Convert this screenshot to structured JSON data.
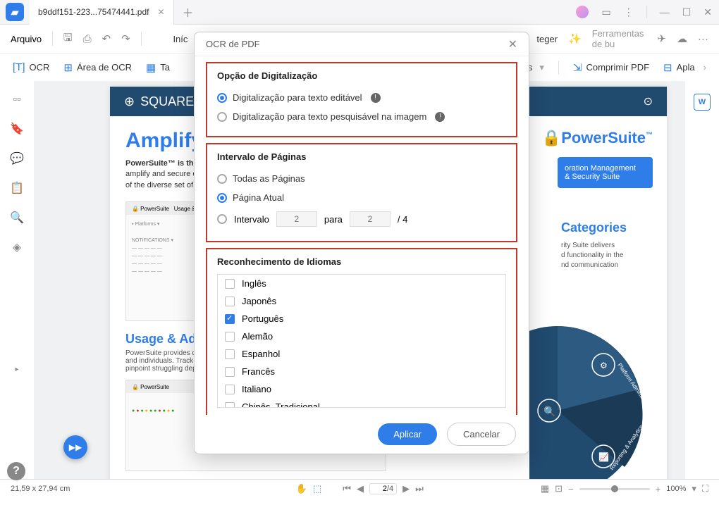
{
  "titlebar": {
    "tab_name": "b9ddf151-223...75474441.pdf"
  },
  "menubar": {
    "file": "Arquivo",
    "home": "Iníc",
    "protect": "teger",
    "ai_tools": "Ferramentas de bu"
  },
  "toolbar": {
    "ocr": "OCR",
    "ocr_area": "Área de OCR",
    "ta": "Ta",
    "vos": "vos",
    "compress": "Comprimir PDF",
    "apla": "Apla"
  },
  "dialog": {
    "title": "OCR de PDF",
    "scan": {
      "title": "Opção de Digitalização",
      "opt1": "Digitalização para texto editável",
      "opt2": "Digitalização para texto pesquisável na imagem"
    },
    "pagerange": {
      "title": "Intervalo de Páginas",
      "all": "Todas as Páginas",
      "current": "Página Atual",
      "range": "Intervalo",
      "from": "2",
      "to_label": "para",
      "to": "2",
      "total": "/ 4"
    },
    "lang": {
      "title": "Reconhecimento de Idiomas",
      "items": [
        {
          "label": "Inglês",
          "checked": false
        },
        {
          "label": "Japonês",
          "checked": false
        },
        {
          "label": "Português",
          "checked": true
        },
        {
          "label": "Alemão",
          "checked": false
        },
        {
          "label": "Espanhol",
          "checked": false
        },
        {
          "label": "Francês",
          "checked": false
        },
        {
          "label": "Italiano",
          "checked": false
        },
        {
          "label": "Chinês_Tradicional",
          "checked": false
        }
      ],
      "selected": "Português"
    },
    "apply": "Aplicar",
    "cancel": "Cancelar"
  },
  "document": {
    "square": "SQUARE",
    "heading": "Amplify C",
    "desc1": "PowerSuite™ is the",
    "desc2": "amplify and secure c",
    "desc3": "of the diverse set of",
    "ps": "PowerSuite",
    "badge1": "oration Management",
    "badge2": "& Security Suite",
    "categories": "Categories",
    "cat1": "rity Suite delivers",
    "cat2": "d functionality in the",
    "cat3": "nd communication",
    "usage": "Usage & Adoption",
    "usage1": "PowerSuite provides det",
    "usage2": "and individuals. Track m",
    "usage3": "pinpoint struggling depa",
    "wheel1": "Platform Administration",
    "wheel2": "Reporting & Analytics"
  },
  "statusbar": {
    "dims": "21,59 x 27,94 cm",
    "page_cur": "2",
    "page_total": "/4",
    "zoom": "100%"
  }
}
